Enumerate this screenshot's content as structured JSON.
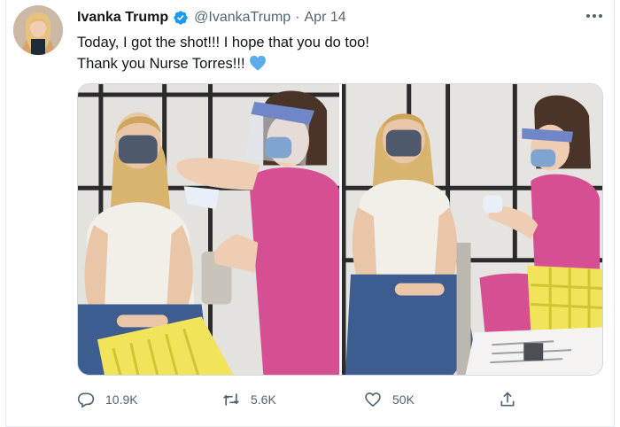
{
  "tweet": {
    "author_name": "Ivanka Trump",
    "handle": "@IvankaTrump",
    "separator": "·",
    "date": "Apr 14",
    "text_line1": "Today, I got the shot!!! I hope that you do too!",
    "text_line2": "Thank you Nurse Torres!!!",
    "emoji": "blue-heart",
    "icons": {
      "verified": "verified-badge-icon",
      "more": "more-horizontal-icon",
      "reply": "reply-icon",
      "retweet": "retweet-icon",
      "like": "like-heart-icon",
      "share": "share-icon"
    },
    "colors": {
      "accent": "#1d9bf0",
      "text": "#0f1419",
      "secondary": "#536471"
    }
  },
  "actions": {
    "replies": "10.9K",
    "retweets": "5.6K",
    "likes": "50K"
  }
}
